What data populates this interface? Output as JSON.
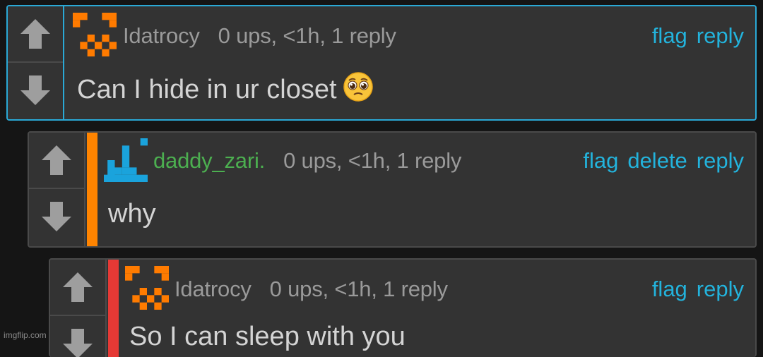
{
  "comments": [
    {
      "username": "Idatrocy",
      "stats": "0 ups, <1h, 1 reply",
      "actions": [
        "flag",
        "reply"
      ],
      "text": "Can I hide in ur closet",
      "emoji": "pleading-face-icon",
      "highlight_color": "#2aa9d6"
    },
    {
      "username": "daddy_zari.",
      "username_color": "#4caf50",
      "stats": "0 ups, <1h, 1 reply",
      "actions": [
        "flag",
        "delete",
        "reply"
      ],
      "text": "why",
      "depth_color": "#ff8400"
    },
    {
      "username": "Idatrocy",
      "stats": "0 ups, <1h, 1 reply",
      "actions": [
        "flag",
        "reply"
      ],
      "text": "So I can sleep with you",
      "depth_color": "#e53935"
    }
  ],
  "icons": {
    "upvote": "arrow-up-icon",
    "downvote": "arrow-down-icon"
  },
  "colors": {
    "link": "#23b3dc",
    "avatar_orange": "#ff7b00",
    "avatar_blue": "#1aa3dc"
  },
  "watermark": "imgflip.com"
}
